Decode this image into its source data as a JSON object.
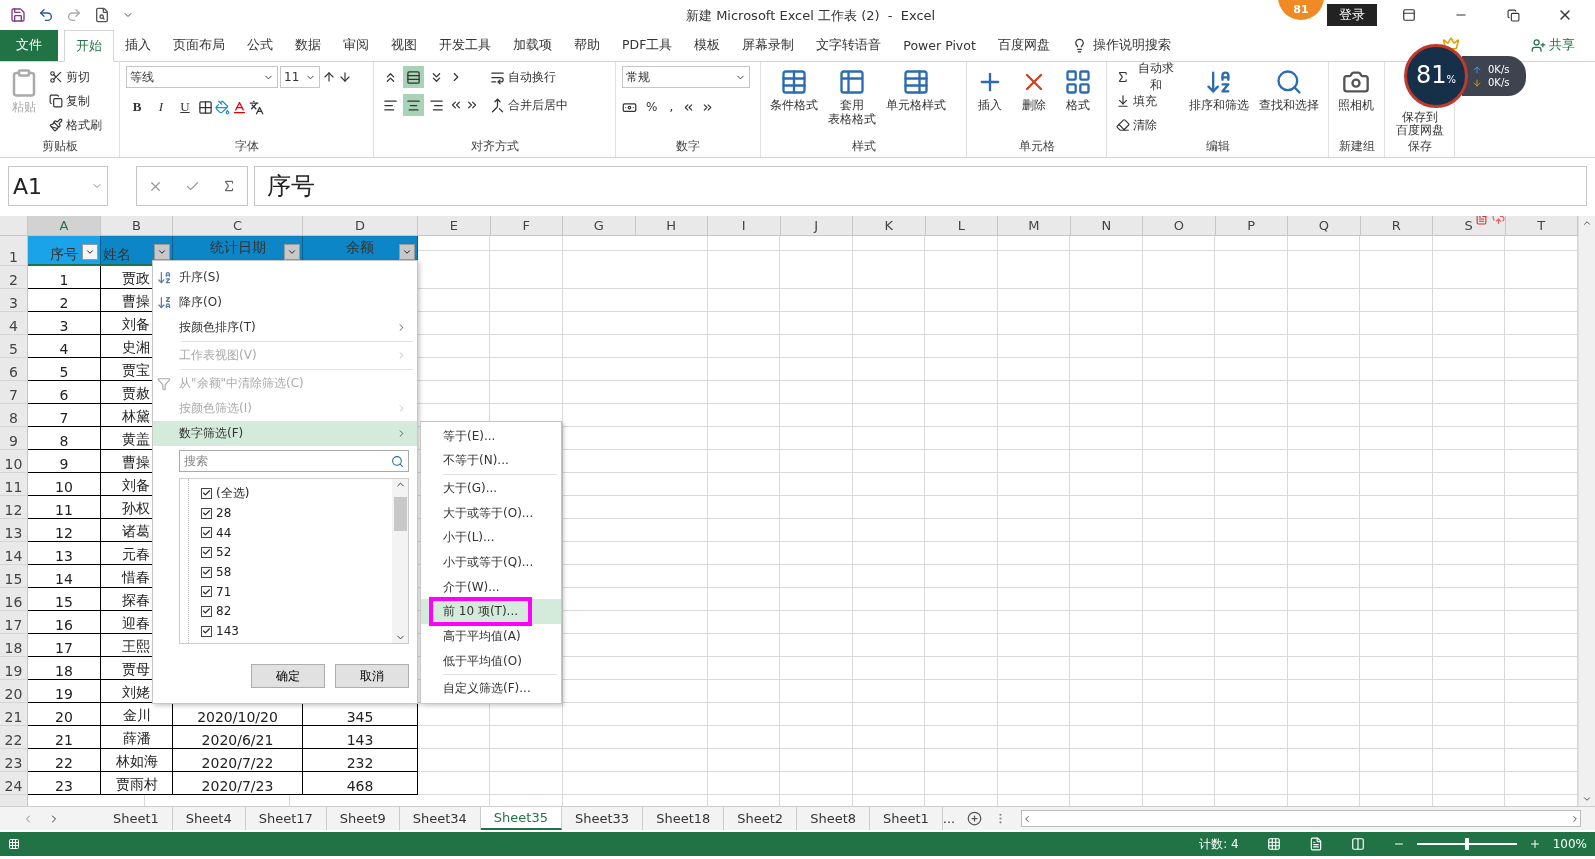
{
  "window": {
    "title": "新建 Microsoft Excel 工作表 (2)  -  Excel",
    "badge": "81",
    "login": "登录"
  },
  "menu_tabs": [
    {
      "label": "文件",
      "kind": "file",
      "selected": false
    },
    {
      "label": "开始",
      "kind": "tab",
      "selected": true
    },
    {
      "label": "插入",
      "kind": "tab",
      "selected": false
    },
    {
      "label": "页面布局",
      "kind": "tab",
      "selected": false
    },
    {
      "label": "公式",
      "kind": "tab",
      "selected": false
    },
    {
      "label": "数据",
      "kind": "tab",
      "selected": false
    },
    {
      "label": "审阅",
      "kind": "tab",
      "selected": false
    },
    {
      "label": "视图",
      "kind": "tab",
      "selected": false
    },
    {
      "label": "开发工具",
      "kind": "tab",
      "selected": false
    },
    {
      "label": "加载项",
      "kind": "tab",
      "selected": false
    },
    {
      "label": "帮助",
      "kind": "tab",
      "selected": false
    },
    {
      "label": "PDF工具",
      "kind": "tab",
      "selected": false
    },
    {
      "label": "模板",
      "kind": "tab",
      "selected": false
    },
    {
      "label": "屏幕录制",
      "kind": "tab",
      "selected": false
    },
    {
      "label": "文字转语音",
      "kind": "tab",
      "selected": false
    },
    {
      "label": "Power Pivot",
      "kind": "tab",
      "selected": false
    },
    {
      "label": "百度网盘",
      "kind": "tab",
      "selected": false
    },
    {
      "label": "操作说明搜索",
      "kind": "search",
      "selected": false
    }
  ],
  "share": "共享",
  "ribbon": {
    "clipboard": {
      "label": "剪贴板",
      "paste": "粘贴",
      "paste_disabled": true,
      "items": [
        "剪切",
        "复制",
        "格式刷"
      ]
    },
    "font": {
      "label": "字体",
      "font_name": "等线",
      "font_size": "11",
      "styles": [
        "B",
        "I",
        "U"
      ]
    },
    "alignment": {
      "label": "对齐方式",
      "buttons": [
        {
          "selected": false
        },
        {
          "selected": true
        },
        {
          "selected": false
        },
        {
          "selected": false
        },
        {
          "selected": true
        },
        {
          "selected": false
        }
      ],
      "wrap": "自动换行",
      "merge": "合并后居中"
    },
    "number": {
      "label": "数字",
      "format": "常规",
      "percent": "%",
      "comma": ","
    },
    "styles": {
      "label": "样式",
      "items": [
        {
          "lines": [
            "条件格式"
          ]
        },
        {
          "lines": [
            "套用",
            "表格格式"
          ]
        },
        {
          "lines": [
            "单元格样式"
          ]
        }
      ]
    },
    "cells": {
      "label": "单元格",
      "items": [
        "插入",
        "删除",
        "格式"
      ]
    },
    "editing": {
      "label": "编辑",
      "small": [
        "自动求和",
        "填充",
        "清除"
      ],
      "large": [
        "排序和筛选",
        "查找和选择"
      ]
    },
    "new_group": {
      "label": "新建组",
      "items": [
        "照相机"
      ]
    },
    "save": {
      "label": "保存",
      "items": [
        {
          "lines": [
            "保存到",
            "百度网盘"
          ]
        }
      ]
    }
  },
  "widget": {
    "percent": "81",
    "unit": "%",
    "upload": "0K/s",
    "download": "0K/s"
  },
  "formula_bar": {
    "name_box": "A1",
    "content": "序号"
  },
  "columns": [
    "A",
    "B",
    "C",
    "D",
    "E",
    "F",
    "G",
    "H",
    "I",
    "J",
    "K",
    "L",
    "M",
    "N",
    "O",
    "P",
    "Q",
    "R",
    "S",
    "T"
  ],
  "header_row": {
    "row": "1",
    "cells": [
      "序号",
      "姓名",
      "统计日期",
      "余额"
    ]
  },
  "rows": [
    {
      "row": "2",
      "seq": "1",
      "name": "贾政"
    },
    {
      "row": "3",
      "seq": "2",
      "name": "曹操"
    },
    {
      "row": "4",
      "seq": "3",
      "name": "刘备"
    },
    {
      "row": "5",
      "seq": "4",
      "name": "史湘"
    },
    {
      "row": "6",
      "seq": "5",
      "name": "贾宝"
    },
    {
      "row": "7",
      "seq": "6",
      "name": "贾赦"
    },
    {
      "row": "8",
      "seq": "7",
      "name": "林黛"
    },
    {
      "row": "9",
      "seq": "8",
      "name": "黄盖"
    },
    {
      "row": "10",
      "seq": "9",
      "name": "曹操"
    },
    {
      "row": "11",
      "seq": "10",
      "name": "刘备"
    },
    {
      "row": "12",
      "seq": "11",
      "name": "孙权"
    },
    {
      "row": "13",
      "seq": "12",
      "name": "诸葛"
    },
    {
      "row": "14",
      "seq": "13",
      "name": "元春"
    },
    {
      "row": "15",
      "seq": "14",
      "name": "惜春"
    },
    {
      "row": "16",
      "seq": "15",
      "name": "探春"
    },
    {
      "row": "17",
      "seq": "16",
      "name": "迎春"
    },
    {
      "row": "18",
      "seq": "17",
      "name": "王熙"
    },
    {
      "row": "19",
      "seq": "18",
      "name": "贾母"
    },
    {
      "row": "20",
      "seq": "19",
      "name": "刘姥"
    },
    {
      "row": "21",
      "seq": "20",
      "name": "金川",
      "date": "2020/10/20",
      "amount": "345"
    },
    {
      "row": "22",
      "seq": "21",
      "name": "薛潘",
      "date": "2020/6/21",
      "amount": "143"
    },
    {
      "row": "23",
      "seq": "22",
      "name": "林如海",
      "date": "2020/7/22",
      "amount": "232"
    },
    {
      "row": "24",
      "seq": "23",
      "name": "贾雨村",
      "date": "2020/7/23",
      "amount": "468"
    }
  ],
  "filter_menu": {
    "items": [
      {
        "label": "升序(S)",
        "kind": "sort-asc",
        "disabled": false,
        "selected": false
      },
      {
        "label": "降序(O)",
        "kind": "sort-desc",
        "disabled": false,
        "selected": false
      },
      {
        "label": "按颜色排序(T)",
        "kind": "submenu",
        "disabled": false,
        "selected": false
      },
      {
        "kind": "separator"
      },
      {
        "label": "工作表视图(V)",
        "kind": "submenu",
        "disabled": true,
        "selected": false
      },
      {
        "kind": "separator"
      },
      {
        "label": "从\"余额\"中清除筛选(C)",
        "kind": "clear",
        "disabled": true,
        "selected": false
      },
      {
        "label": "按颜色筛选(I)",
        "kind": "submenu",
        "disabled": true,
        "selected": false
      },
      {
        "label": "数字筛选(F)",
        "kind": "submenu",
        "disabled": false,
        "selected": true
      }
    ],
    "search": {
      "placeholder": "搜索"
    },
    "values": [
      {
        "label": "(全选)",
        "checked": true
      },
      {
        "label": "28",
        "checked": true
      },
      {
        "label": "44",
        "checked": true
      },
      {
        "label": "52",
        "checked": true
      },
      {
        "label": "58",
        "checked": true
      },
      {
        "label": "71",
        "checked": true
      },
      {
        "label": "82",
        "checked": true
      },
      {
        "label": "143",
        "checked": true
      }
    ],
    "buttons": [
      "确定",
      "取消"
    ]
  },
  "number_filter_menu": [
    {
      "label": "等于(E)...",
      "kind": "item",
      "selected": false,
      "marked": false
    },
    {
      "label": "不等于(N)...",
      "kind": "item",
      "selected": false,
      "marked": false
    },
    {
      "kind": "separator"
    },
    {
      "label": "大于(G)...",
      "kind": "item",
      "selected": false,
      "marked": false
    },
    {
      "label": "大于或等于(O)...",
      "kind": "item",
      "selected": false,
      "marked": false
    },
    {
      "label": "小于(L)...",
      "kind": "item",
      "selected": false,
      "marked": false
    },
    {
      "label": "小于或等于(Q)...",
      "kind": "item",
      "selected": false,
      "marked": false
    },
    {
      "label": "介于(W)...",
      "kind": "item",
      "selected": false,
      "marked": false
    },
    {
      "label": "前 10 项(T)...",
      "kind": "item",
      "selected": true,
      "marked": true
    },
    {
      "label": "高于平均值(A)",
      "kind": "item",
      "selected": false,
      "marked": false
    },
    {
      "label": "低于平均值(O)",
      "kind": "item",
      "selected": false,
      "marked": false
    },
    {
      "kind": "separator"
    },
    {
      "label": "自定义筛选(F)...",
      "kind": "item",
      "selected": false,
      "marked": false
    }
  ],
  "sheet_tabs": [
    {
      "label": "Sheet1",
      "selected": false
    },
    {
      "label": "Sheet4",
      "selected": false
    },
    {
      "label": "Sheet17",
      "selected": false
    },
    {
      "label": "Sheet9",
      "selected": false
    },
    {
      "label": "Sheet34",
      "selected": false
    },
    {
      "label": "Sheet35",
      "selected": true
    },
    {
      "label": "Sheet33",
      "selected": false
    },
    {
      "label": "Sheet18",
      "selected": false
    },
    {
      "label": "Sheet2",
      "selected": false
    },
    {
      "label": "Sheet8",
      "selected": false
    },
    {
      "label": "Sheet1",
      "selected": false
    }
  ],
  "more_sheets": "...",
  "status_bar": {
    "count": "计数: 4",
    "zoom": {
      "level": 0.5,
      "reading": "100%"
    }
  }
}
